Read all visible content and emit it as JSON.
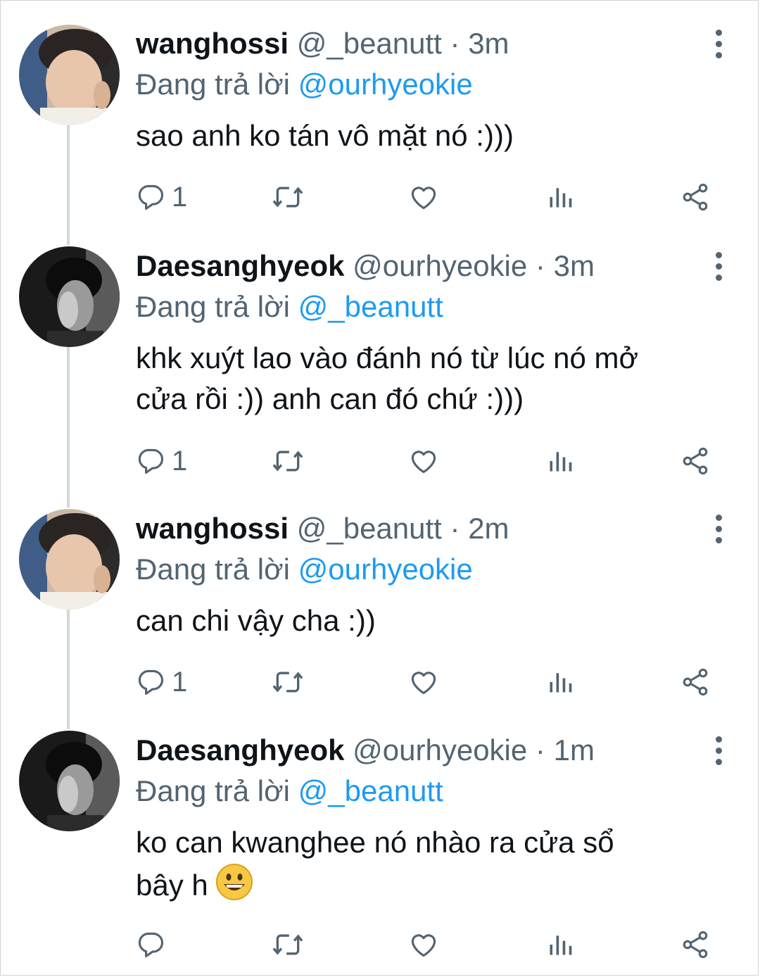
{
  "tweets": [
    {
      "name": "wanghossi",
      "handle": "@_beanutt",
      "separator": "·",
      "time": "3m",
      "reply_prefix": "Đang trả lời",
      "reply_to": "@ourhyeokie",
      "lines": [
        "sao anh ko tán vô mặt nó :)))"
      ],
      "reply_count": "1",
      "avatar": "user-photo-light"
    },
    {
      "name": "Daesanghyeok",
      "handle": "@ourhyeokie",
      "separator": "·",
      "time": "3m",
      "reply_prefix": "Đang trả lời",
      "reply_to": "@_beanutt",
      "lines": [
        "khk xuýt lao vào đánh nó từ lúc nó mở",
        "cửa rồi :)) anh can đó chứ :)))"
      ],
      "reply_count": "1",
      "avatar": "user-photo-dark"
    },
    {
      "name": "wanghossi",
      "handle": "@_beanutt",
      "separator": "·",
      "time": "2m",
      "reply_prefix": "Đang trả lời",
      "reply_to": "@ourhyeokie",
      "lines": [
        "can chi vậy cha :))"
      ],
      "reply_count": "1",
      "avatar": "user-photo-light"
    },
    {
      "name": "Daesanghyeok",
      "handle": "@ourhyeokie",
      "separator": "·",
      "time": "1m",
      "reply_prefix": "Đang trả lời",
      "reply_to": "@_beanutt",
      "lines": [
        "ko can kwanghee nó nhào ra cửa sổ",
        "bây h"
      ],
      "emoji": "grinning-face",
      "reply_count": "",
      "avatar": "user-photo-dark"
    }
  ],
  "icons": [
    "reply-icon",
    "retweet-icon",
    "like-icon",
    "analytics-icon",
    "share-icon",
    "more-options-icon"
  ],
  "colors": {
    "link": "#1d9bf0",
    "secondary": "#536471",
    "text": "#0f1419",
    "thread_line": "#cfd9de"
  }
}
